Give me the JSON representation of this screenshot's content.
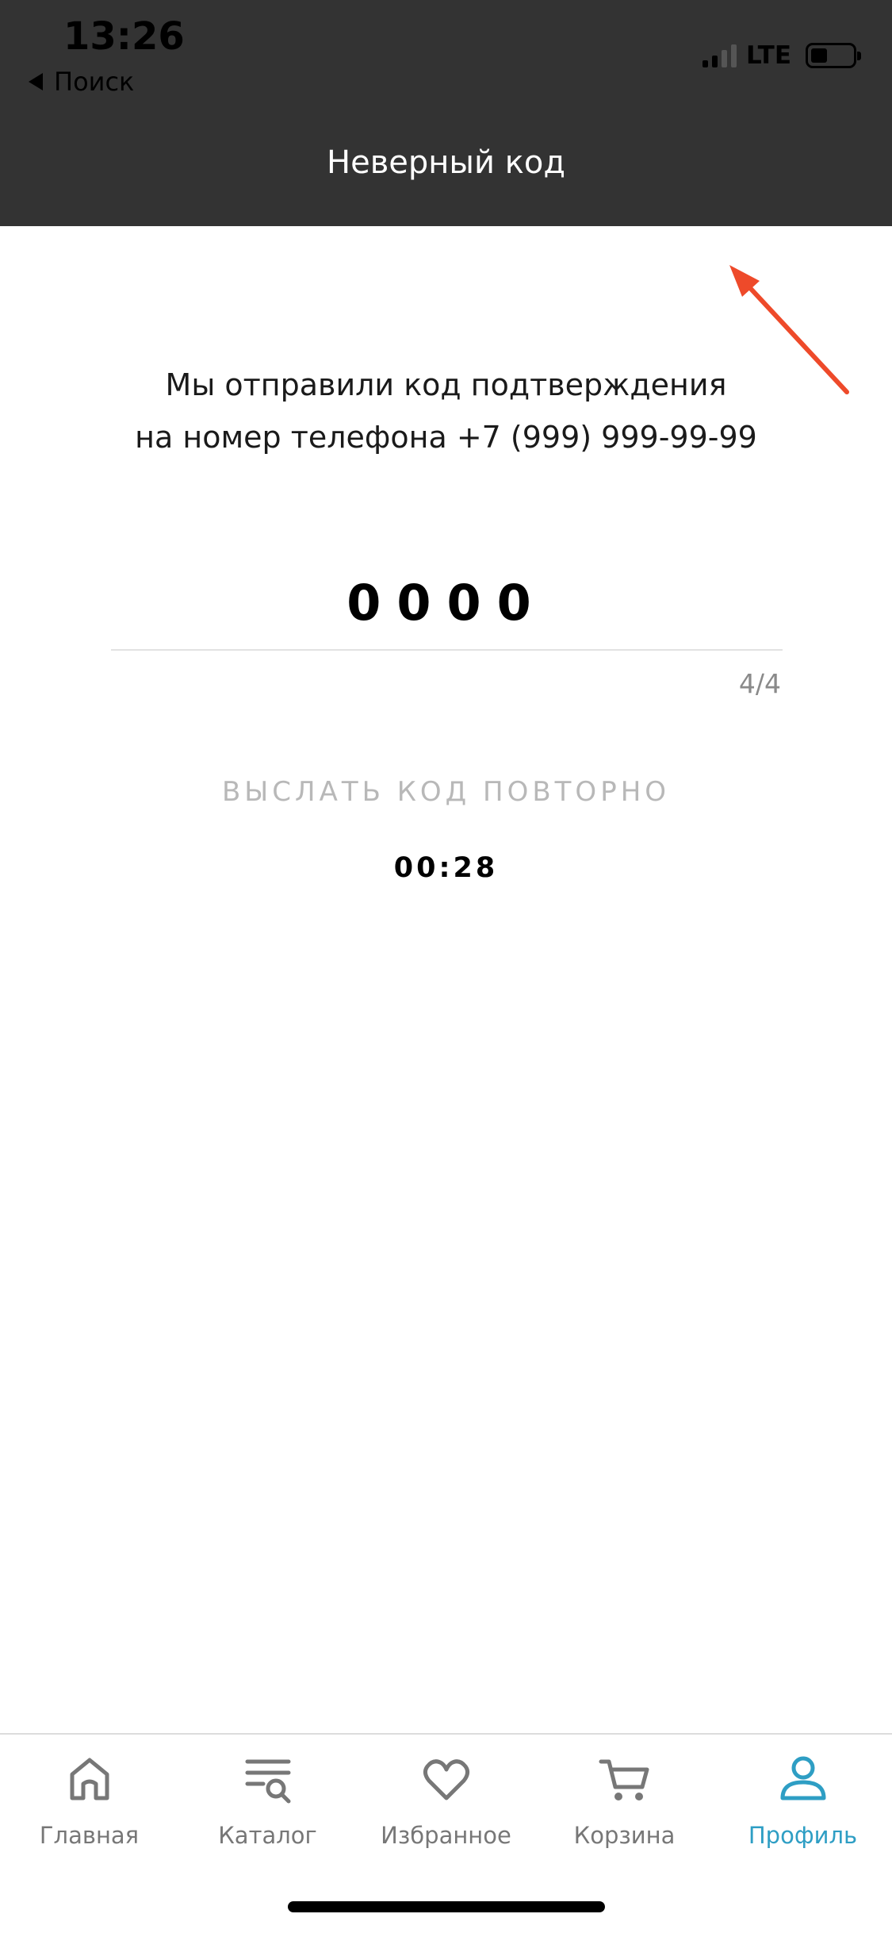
{
  "status_bar": {
    "time": "13:26",
    "back_label": "Поиск",
    "network": "LTE"
  },
  "header": {
    "title": "Неверный код"
  },
  "verification": {
    "message_line1": "Мы отправили код подтверждения",
    "message_line2": "на номер телефона +7 (999) 999-99-99",
    "code_value": "0000",
    "counter": "4/4",
    "resend_label": "ВЫСЛАТЬ КОД ПОВТОРНО",
    "timer": "00:28"
  },
  "tabbar": {
    "items": [
      {
        "label": "Главная",
        "icon": "home-icon"
      },
      {
        "label": "Каталог",
        "icon": "catalog-icon"
      },
      {
        "label": "Избранное",
        "icon": "heart-icon"
      },
      {
        "label": "Корзина",
        "icon": "cart-icon"
      },
      {
        "label": "Профиль",
        "icon": "profile-icon"
      }
    ],
    "active_index": 4
  },
  "colors": {
    "header_bg": "#333333",
    "accent": "#2e9ec4",
    "annotation_arrow": "#ee4a2a",
    "inactive_tab": "#777777",
    "resend_disabled": "#b8b8b8"
  }
}
